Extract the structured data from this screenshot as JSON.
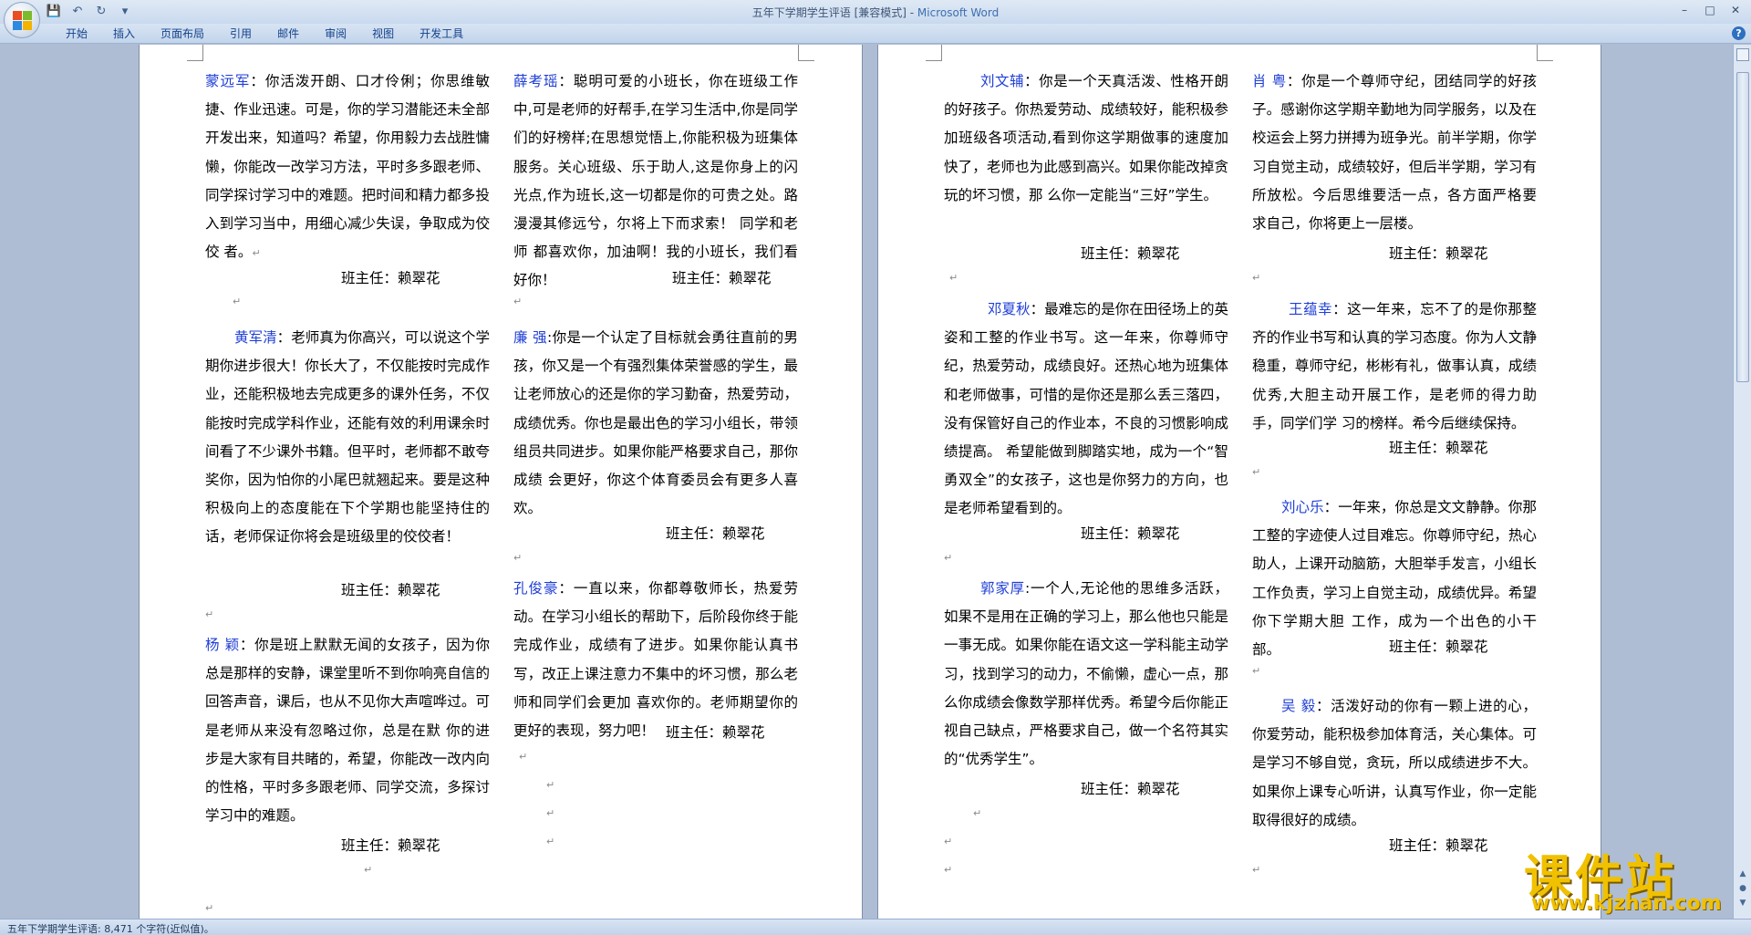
{
  "window": {
    "title_doc": "五年下学期学生评语 [兼容模式] - ",
    "title_app": "Microsoft Word"
  },
  "qat": {
    "save_icon": "💾",
    "undo_icon": "↶",
    "redo_icon": "↻",
    "customize_icon": "▾"
  },
  "win_controls": {
    "minimize": "–",
    "maximize": "□",
    "close": "✕"
  },
  "ribbon": {
    "tabs": [
      "开始",
      "插入",
      "页面布局",
      "引用",
      "邮件",
      "审阅",
      "视图",
      "开发工具"
    ],
    "help": "?"
  },
  "signature": "班主任：赖翠花",
  "para_mark": "↵",
  "page_left": {
    "col1": [
      {
        "name": "蒙远军",
        "text": "：你活泼开朗、口才伶俐；你思维敏捷、作业迅速。可是，你的学习潜能还未全部开发出来，知道吗？希望，你用毅力去战胜慵懒，你能改一改学习方法，平时多多跟老师、同学探讨学习中的难题。把时间和精力都多投入到学习当中，用细心减少失误，争取成为佼佼 者。"
      },
      {
        "name": "黄军清",
        "text": "：老师真为你高兴，可以说这个学期你进步很大！你长大了，不仅能按时完成作业，还能积极地去完成更多的课外任务，不仅能按时完成学科作业，还能有效的利用课余时间看了不少课外书籍。但平时，老师都不敢夸奖你，因为怕你的小尾巴就翘起来。要是这种 积极向上的态度能在下个学期也能坚持住的话，老师保证你将会是班级里的佼佼者！"
      },
      {
        "name": "杨  颖",
        "text": "：你是班上默默无闻的女孩子，因为你总是那样的安静，课堂里听不到你响亮自信的回答声音，课后，也从不见你大声喧哗过。可是老师从来没有忽略过你，总是在默 你的进步是大家有目共睹的，希望，你能改一改内向 的性格，平时多多跟老师、同学交流，多探讨学习中的难题。"
      }
    ],
    "col2": [
      {
        "name": "薛考瑶",
        "text": "：聪明可爱的小班长，你在班级工作中,可是老师的好帮手,在学习生活中,你是同学们的好榜样;在思想觉悟上,你能积极为班集体服务。关心班级、乐于助人,这是你身上的闪光点,作为班长,这一切都是你的可贵之处。路漫漫其修远兮，尔将上下而求索！ 同学和老师 都喜欢你，加油啊！我的小班长，我们看好你！"
      },
      {
        "name": "廉  强",
        "text": ":你是一个认定了目标就会勇往直前的男孩，你又是一个有强烈集体荣誉感的学生，最让老师放心的还是你的学习勤奋，热爱劳动，成绩优秀。你也是最出色的学习小组长，带领组员共同进步。如果你能严格要求自己，那你成绩 会更好，你这个体育委员会有更多人喜欢。"
      },
      {
        "name": "孔俊豪",
        "text": "：一直以来，你都尊敬师长，热爱劳动。在学习小组长的帮助下，后阶段你终于能完成作业，成绩有了进步。如果你能认真书写，改正上课注意力不集中的坏习惯，那么老师和同学们会更加 喜欢你的。老师期望你的更好的表现，努力吧！"
      }
    ]
  },
  "page_right": {
    "col1": [
      {
        "name": "刘文辅",
        "text": "：你是一个天真活泼、性格开朗的好孩子。你热爱劳动、成绩较好，能积极参加班级各项活动,看到你这学期做事的速度加快了，老师也为此感到高兴。如果你能改掉贪玩的坏习惯，那 么你一定能当“三好”学生。"
      },
      {
        "name": "邓夏秋",
        "text": "：最难忘的是你在田径场上的英姿和工整的作业书写。这一年来，你尊师守纪，热爱劳动，成绩良好。还热心地为班集体和老师做事，可惜的是你还是那么丢三落四，没有保管好自己的作业本，不良的习惯影响成绩提高。 希望能做到脚踏实地，成为一个“智勇双全”的女孩子，这也是你努力的方向，也是老师希望看到的。"
      },
      {
        "name": "郭家厚",
        "text": ":一个人,无论他的思维多活跃，如果不是用在正确的学习上，那么他也只能是一事无成。如果你能在语文这一学科能主动学习，找到学习的动力，不偷懒，虚心一点，那么你成绩会像数学那样优秀。希望今后你能正视自己缺点，严格要求自己，做一个名符其实的“优秀学生”。"
      }
    ],
    "col2": [
      {
        "name": "肖  粤",
        "text": "：你是一个尊师守纪，团结同学的好孩子。感谢你这学期辛勤地为同学服务，以及在校运会上努力拼搏为班争光。前半学期，你学习自觉主动，成绩较好，但后半学期，学习有所放松。今后思维要活一点，各方面严格要 求自己，你将更上一层楼。"
      },
      {
        "name": "王蕴幸",
        "text": "：这一年来，忘不了的是你那整齐的作业书写和认真的学习态度。你为人文静稳重，尊师守纪，彬彬有礼，做事认真，成绩优秀,大胆主动开展工作，是老师的得力助手，同学们学 习的榜样。希今后继续保持。"
      },
      {
        "name": "刘心乐",
        "text": "：一年来，你总是文文静静。你那工整的字迹使人过目难忘。你尊师守纪，热心助人，上课开动脑筋，大胆举手发言，小组长工作负责，学习上自觉主动，成绩优异。希望你下学期大胆 工作，成为一个出色的小干部。"
      },
      {
        "name": "吴  毅",
        "text": "：活泼好动的你有一颗上进的心，你爱劳动，能积极参加体育活，关心集体。可是学习不够自觉，贪玩，所以成绩进步不大。如果你上课专心听讲，认真写作业，你一定能取得很好的成绩。"
      }
    ]
  },
  "status": {
    "text": "五年下学期学生评语: 8,471 个字符(近似值)。"
  },
  "watermark": {
    "title": "课件站",
    "url": "www.kjzhan.com"
  },
  "colors": {
    "name_blue": "#1f3fd6",
    "watermark_yellow": "#f0c100"
  }
}
